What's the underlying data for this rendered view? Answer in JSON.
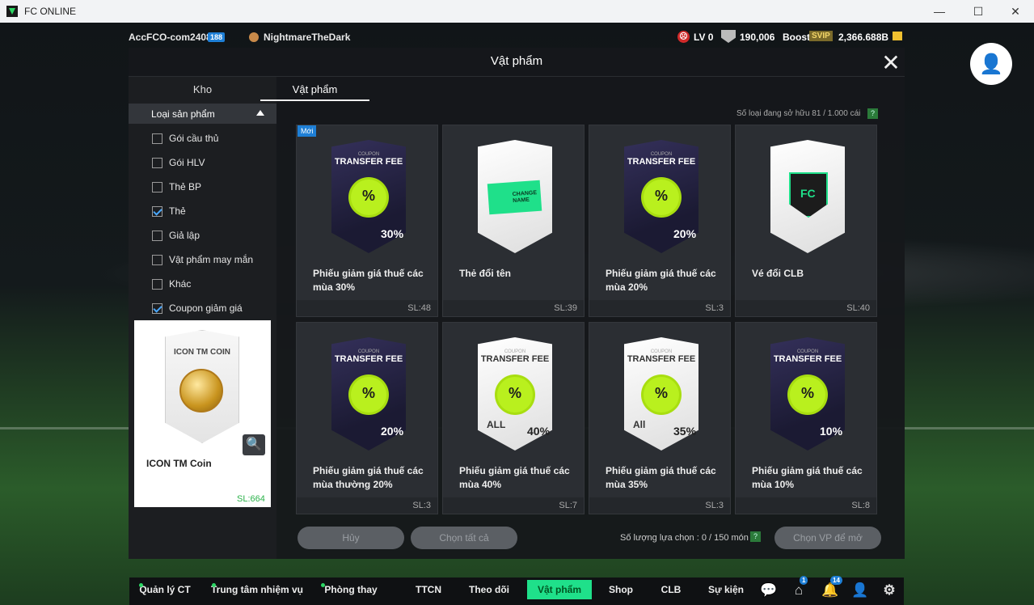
{
  "window": {
    "title": "FC ONLINE",
    "minimize": "—",
    "maximize": "☐",
    "close": "✕"
  },
  "topbar": {
    "account": "AccFCO-com2408i",
    "account_level": "188",
    "team": "NightmareTheDark",
    "lv": "LV 0",
    "coins": "190,006",
    "boost_label": "Boost",
    "svip": "SVIP",
    "bp": "2,366.688B"
  },
  "modal": {
    "title": "Vật phẩm",
    "close": "✕",
    "tabs": [
      {
        "label": "Kho"
      },
      {
        "label": "Vật phẩm"
      }
    ],
    "category_header": "Loại sản phẩm",
    "categories": [
      {
        "label": "Gói cầu thủ",
        "checked": false
      },
      {
        "label": "Gói HLV",
        "checked": false
      },
      {
        "label": "Thẻ BP",
        "checked": false
      },
      {
        "label": "Thẻ",
        "checked": true
      },
      {
        "label": "Giả lập",
        "checked": false
      },
      {
        "label": "Vật phẩm may mắn",
        "checked": false
      },
      {
        "label": "Khác",
        "checked": false
      },
      {
        "label": "Coupon giảm giá",
        "checked": true
      }
    ],
    "preview": {
      "card_title": "ICON TM COIN",
      "name": "ICON TM Coin",
      "qty": "SL:664",
      "zoom_icon": "magnifier-icon"
    },
    "new_tag": "Mới",
    "owned_label": "Số loại đang sở hữu   81 / 1.000 cái",
    "help": "?",
    "items": [
      {
        "name": "Phiếu giảm giá thuế các mùa 30%",
        "qty": "SL:48",
        "style": "dark",
        "kind": "coupon",
        "top": "COUPON",
        "title": "TRANSFER FEE",
        "badge": "%",
        "disc": "30%"
      },
      {
        "name": "Thẻ đổi tên",
        "qty": "SL:39",
        "style": "light",
        "kind": "rename",
        "label": "CHANGE NAME"
      },
      {
        "name": "Phiếu giảm giá thuế các mùa 20%",
        "qty": "SL:3",
        "style": "dark",
        "kind": "coupon",
        "top": "COUPON",
        "title": "TRANSFER FEE",
        "badge": "%",
        "disc": "20%"
      },
      {
        "name": "Vé đổi CLB",
        "qty": "SL:40",
        "style": "light",
        "kind": "club"
      },
      {
        "name": "Phiếu giảm giá thuế các mùa thường 20%",
        "qty": "SL:3",
        "style": "dark",
        "kind": "coupon",
        "top": "COUPON",
        "title": "TRANSFER FEE",
        "badge": "%",
        "disc": "20%"
      },
      {
        "name": "Phiếu giảm giá thuế các mùa 40%",
        "qty": "SL:7",
        "style": "light",
        "kind": "coupon",
        "top": "COUPON",
        "title": "TRANSFER FEE",
        "badge": "%",
        "disc": "40%",
        "all": "ALL"
      },
      {
        "name": "Phiếu giảm giá thuế các mùa 35%",
        "qty": "SL:3",
        "style": "light",
        "kind": "coupon",
        "top": "COUPON",
        "title": "TRANSFER FEE",
        "badge": "%",
        "disc": "35%",
        "all": "All"
      },
      {
        "name": "Phiếu giảm giá thuế các mùa 10%",
        "qty": "SL:8",
        "style": "dark",
        "kind": "coupon",
        "top": "COUPON",
        "title": "TRANSFER FEE",
        "badge": "%",
        "disc": "10%"
      }
    ],
    "buttons": {
      "cancel": "Hủy",
      "select_all": "Chọn tất cả",
      "sell": "Chọn VP để mở"
    },
    "selection_label": "Số lượng lựa chọn : 0 / 150 món"
  },
  "navbar": {
    "items": [
      {
        "label": "Quản lý CT",
        "dot": true
      },
      {
        "label": "Trung tâm nhiệm vụ",
        "dot": true
      },
      {
        "label": "Phòng thay đồ",
        "dot": true
      },
      {
        "label": "TTCN",
        "dot": false
      },
      {
        "label": "Theo dõi",
        "dot": false
      },
      {
        "label": "Vật phẩm",
        "dot": false,
        "active": true
      },
      {
        "label": "Shop",
        "dot": false
      },
      {
        "label": "CLB",
        "dot": false
      },
      {
        "label": "Sự kiện",
        "dot": false
      }
    ],
    "icons": [
      {
        "name": "chat-icon",
        "glyph": "💬"
      },
      {
        "name": "home-icon",
        "glyph": "⌂",
        "badge": "1"
      },
      {
        "name": "bell-icon",
        "glyph": "🔔",
        "badge": "14"
      },
      {
        "name": "profile-icon",
        "glyph": "👤"
      },
      {
        "name": "settings-icon",
        "glyph": "⚙"
      }
    ]
  },
  "colors": {
    "accent": "#1fe08a",
    "badge_blue": "#1e7fd6",
    "coupon_green": "#b9f01e"
  }
}
